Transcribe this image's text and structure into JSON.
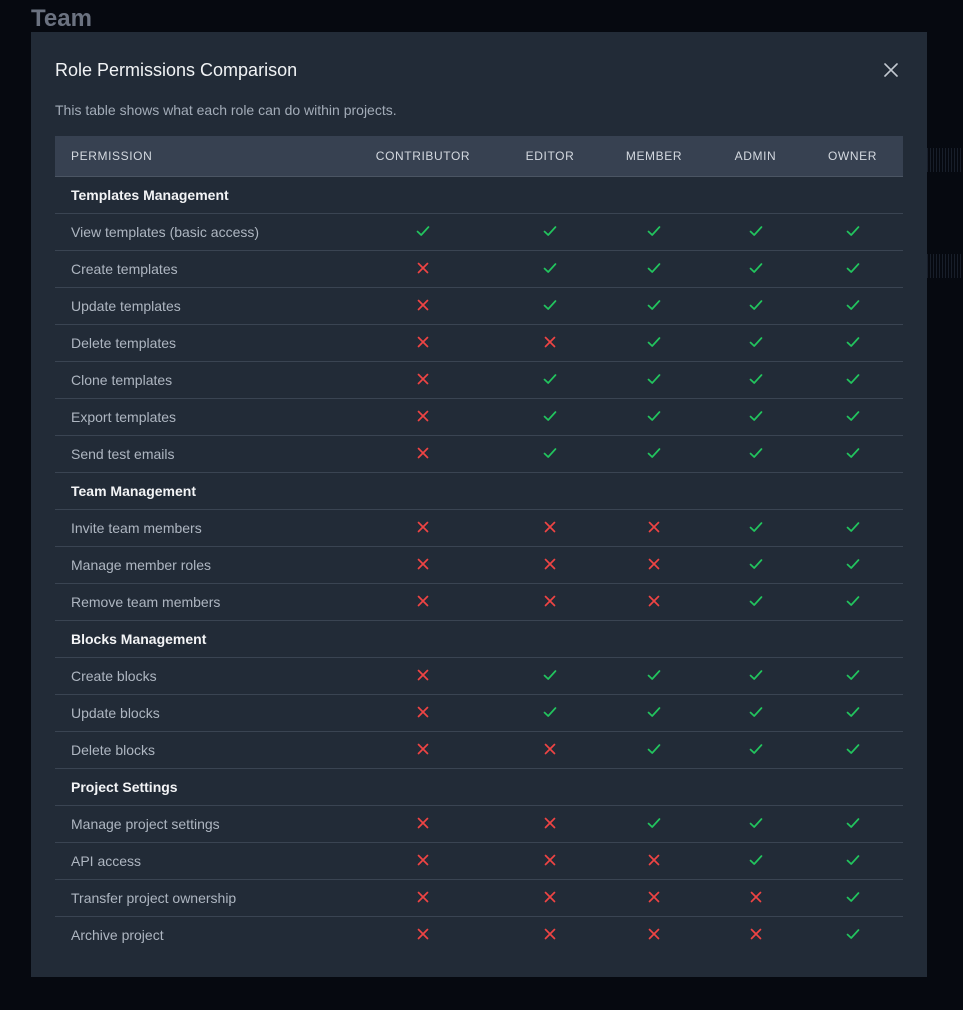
{
  "page": {
    "title": "Team"
  },
  "modal": {
    "title": "Role Permissions Comparison",
    "description": "This table shows what each role can do within projects.",
    "close_icon": "close-icon"
  },
  "colors": {
    "allowed": "#22c55e",
    "denied": "#ef4444",
    "modal_bg": "#222b37",
    "header_bg": "#374151"
  },
  "table": {
    "permission_header": "PERMISSION",
    "roles": [
      "CONTRIBUTOR",
      "EDITOR",
      "MEMBER",
      "ADMIN",
      "OWNER"
    ],
    "sections": [
      {
        "title": "Templates Management",
        "rows": [
          {
            "label": "View templates (basic access)",
            "values": [
              true,
              true,
              true,
              true,
              true
            ]
          },
          {
            "label": "Create templates",
            "values": [
              false,
              true,
              true,
              true,
              true
            ]
          },
          {
            "label": "Update templates",
            "values": [
              false,
              true,
              true,
              true,
              true
            ]
          },
          {
            "label": "Delete templates",
            "values": [
              false,
              false,
              true,
              true,
              true
            ]
          },
          {
            "label": "Clone templates",
            "values": [
              false,
              true,
              true,
              true,
              true
            ]
          },
          {
            "label": "Export templates",
            "values": [
              false,
              true,
              true,
              true,
              true
            ]
          },
          {
            "label": "Send test emails",
            "values": [
              false,
              true,
              true,
              true,
              true
            ]
          }
        ]
      },
      {
        "title": "Team Management",
        "rows": [
          {
            "label": "Invite team members",
            "values": [
              false,
              false,
              false,
              true,
              true
            ]
          },
          {
            "label": "Manage member roles",
            "values": [
              false,
              false,
              false,
              true,
              true
            ]
          },
          {
            "label": "Remove team members",
            "values": [
              false,
              false,
              false,
              true,
              true
            ]
          }
        ]
      },
      {
        "title": "Blocks Management",
        "rows": [
          {
            "label": "Create blocks",
            "values": [
              false,
              true,
              true,
              true,
              true
            ]
          },
          {
            "label": "Update blocks",
            "values": [
              false,
              true,
              true,
              true,
              true
            ]
          },
          {
            "label": "Delete blocks",
            "values": [
              false,
              false,
              true,
              true,
              true
            ]
          }
        ]
      },
      {
        "title": "Project Settings",
        "rows": [
          {
            "label": "Manage project settings",
            "values": [
              false,
              false,
              true,
              true,
              true
            ]
          },
          {
            "label": "API access",
            "values": [
              false,
              false,
              false,
              true,
              true
            ]
          },
          {
            "label": "Transfer project ownership",
            "values": [
              false,
              false,
              false,
              false,
              true
            ]
          },
          {
            "label": "Archive project",
            "values": [
              false,
              false,
              false,
              false,
              true
            ]
          }
        ]
      }
    ]
  }
}
